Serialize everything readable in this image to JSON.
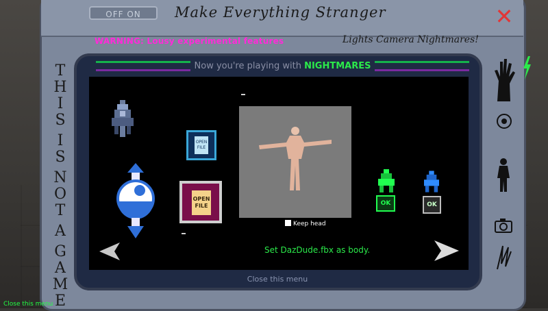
{
  "device": {
    "switch_label": "OFF  ON",
    "title": "Make Everything Stranger",
    "warning": "WARNING: Lousy experimental features",
    "top_scribble": "Lights  Camera  Nightmares!",
    "side_text": [
      "T",
      "H",
      "I",
      "S",
      "",
      "I",
      "S",
      "",
      "N",
      "O",
      "T",
      "",
      "A",
      "",
      "G",
      "A",
      "M",
      "E"
    ]
  },
  "screen": {
    "header_prefix": "Now you're playing with ",
    "header_highlight": "NIGHTMARES",
    "keep_head_label": "Keep head",
    "status": "Set DazDude.fbx as body.",
    "close_menu": "Close this menu"
  },
  "open_file_label_small": "OPEN FILE",
  "open_file_label_large": "OPEN FILE",
  "ok_label_1": "OK",
  "ok_label_2": "OK",
  "footer_close": "Close this menu",
  "colors": {
    "accent_green": "#2bea4a",
    "warning_magenta": "#ff2ad9",
    "close_red": "#e23636",
    "header_purple": "#7b2aa0"
  },
  "icons": [
    "close-icon",
    "left-arrow-icon",
    "right-arrow-icon",
    "ship-icon",
    "potion-icon",
    "camera-icon",
    "hand-icon",
    "figure-icon",
    "target-icon"
  ]
}
